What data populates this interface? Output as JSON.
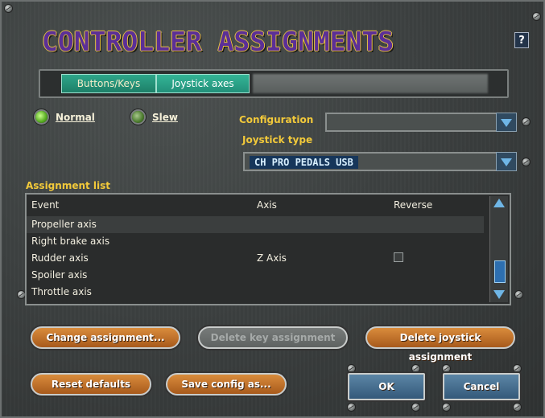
{
  "window": {
    "title": "CONTROLLER ASSIGNMENTS",
    "help_label": "?"
  },
  "tabs": [
    {
      "label": "Buttons/Keys",
      "active": false
    },
    {
      "label": "Joystick axes",
      "active": true
    }
  ],
  "mode": {
    "normal_label": "Normal",
    "slew_label": "Slew",
    "selected": "Normal"
  },
  "configuration": {
    "label": "Configuration",
    "value": ""
  },
  "joystick_type": {
    "label": "Joystick type",
    "value": "CH PRO PEDALS USB"
  },
  "assignment_list": {
    "label": "Assignment list",
    "columns": [
      "Event",
      "Axis",
      "Reverse"
    ],
    "rows": [
      {
        "event": "Propeller axis",
        "axis": "",
        "reverse": null,
        "selected": true
      },
      {
        "event": "Right brake axis",
        "axis": "",
        "reverse": null
      },
      {
        "event": "Rudder axis",
        "axis": "Z Axis",
        "reverse": false
      },
      {
        "event": "Spoiler axis",
        "axis": "",
        "reverse": null
      },
      {
        "event": "Throttle axis",
        "axis": "",
        "reverse": null
      }
    ]
  },
  "buttons": {
    "change_assignment": "Change assignment...",
    "delete_key_assignment": "Delete key assignment",
    "delete_joystick_assignment": "Delete joystick assignment",
    "reset_defaults": "Reset defaults",
    "save_config_as": "Save config as...",
    "ok": "OK",
    "cancel": "Cancel"
  },
  "colors": {
    "title_fill": "#5b2f97",
    "title_outline": "#e8c243",
    "tab_active": "#34b596",
    "label_yellow": "#f2c93a",
    "button_orange": "#d98c3c",
    "button_blue": "#5c86a6"
  }
}
